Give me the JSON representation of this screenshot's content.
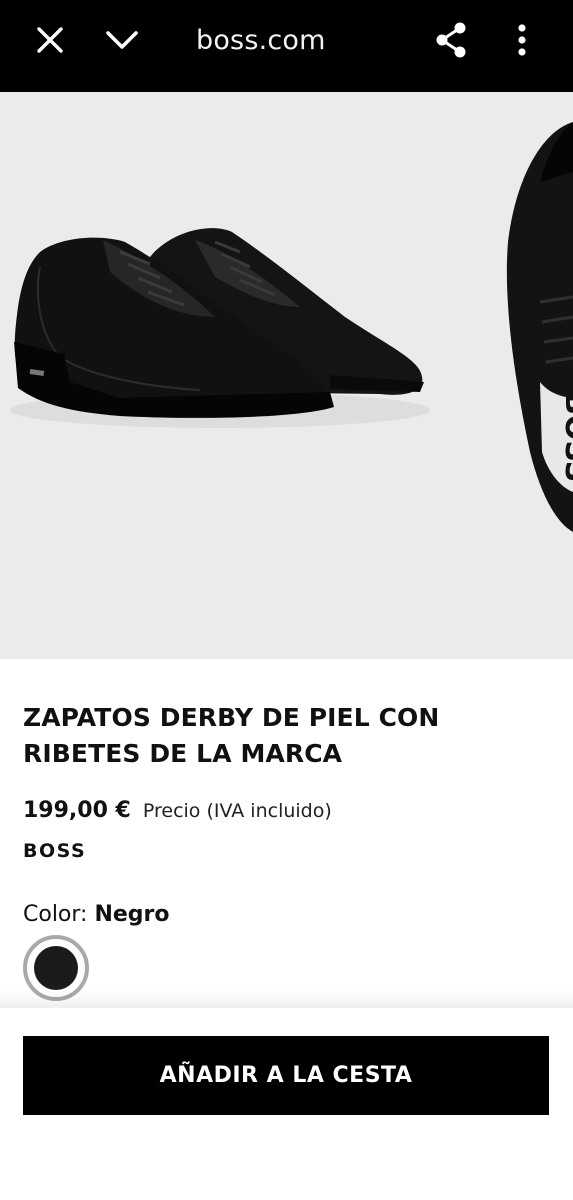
{
  "browser": {
    "url": "boss.com",
    "icons": {
      "close": "close-icon",
      "collapse": "chevron-down-icon",
      "share": "share-icon",
      "more": "more-vertical-icon"
    }
  },
  "product": {
    "title": "ZAPATOS DERBY DE PIEL CON RIBETES DE LA MARCA",
    "price": "199,00 €",
    "price_note": "Precio (IVA incluido)",
    "brand": "BOSS",
    "color_label": "Color:",
    "color_value": "Negro",
    "swatch_color": "#1b1b1e",
    "image_logo_text": "BOSS"
  },
  "actions": {
    "add_to_cart": "AÑADIR A LA CESTA"
  }
}
